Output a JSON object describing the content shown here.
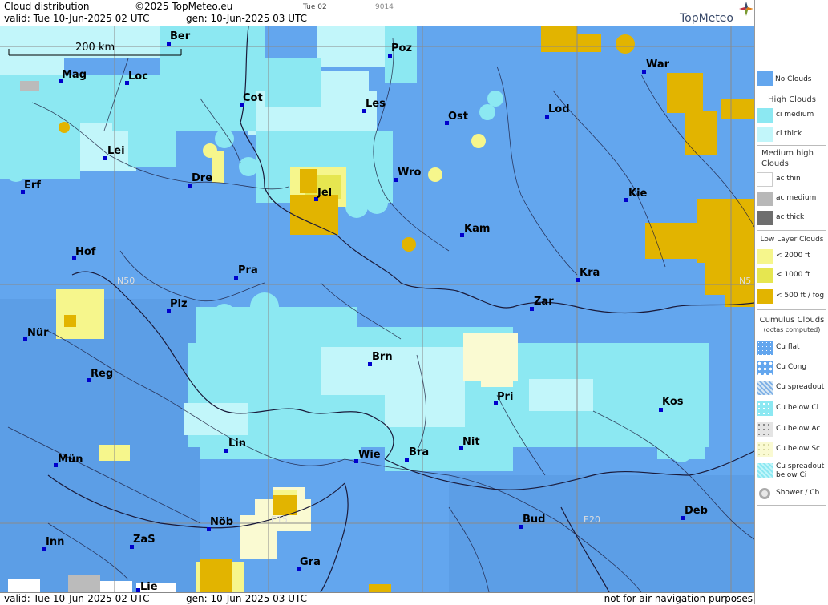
{
  "header": {
    "title": "Cloud distribution",
    "copyright": "©2025 TopMeteo.eu",
    "valid": "valid:  Tue  10-Jun-2025  02 UTC",
    "gen": "gen: 10-Jun-2025 03 UTC",
    "tab": "Tue 02",
    "code": "9014",
    "logo": "TopMeteo"
  },
  "footer": {
    "valid": "valid:  Tue  10-Jun-2025  02 UTC",
    "gen": "gen: 10-Jun-2025 03 UTC",
    "note": "not for air navigation purposes"
  },
  "map": {
    "scale_label": "200 km",
    "grid_labels": [
      "N50",
      "E15",
      "E20",
      "N5"
    ],
    "colors": {
      "no_clouds": "#63a6ee",
      "ci_medium": "#8ce8f2",
      "ci_thick": "#c2f6fa",
      "low_2000": "#f6f68c",
      "low_1000": "#e6e650",
      "fog": "#e2b400",
      "cu_below_sc": "#fafad2",
      "grid": "#8a8a8a",
      "border": "#222244"
    },
    "cities": [
      {
        "name": "Ber"
      },
      {
        "name": "Poz"
      },
      {
        "name": "War"
      },
      {
        "name": "Mag"
      },
      {
        "name": "Loc"
      },
      {
        "name": "Cot"
      },
      {
        "name": "Les"
      },
      {
        "name": "Ost"
      },
      {
        "name": "Lod"
      },
      {
        "name": "Lei"
      },
      {
        "name": "Wro"
      },
      {
        "name": "Erf"
      },
      {
        "name": "Dre"
      },
      {
        "name": "Jel"
      },
      {
        "name": "Kie"
      },
      {
        "name": "Kam"
      },
      {
        "name": "Hof"
      },
      {
        "name": "Pra"
      },
      {
        "name": "Kra"
      },
      {
        "name": "Zar"
      },
      {
        "name": "Plz"
      },
      {
        "name": "Nür"
      },
      {
        "name": "Brn"
      },
      {
        "name": "Reg"
      },
      {
        "name": "Pri"
      },
      {
        "name": "Kos"
      },
      {
        "name": "Lin"
      },
      {
        "name": "Nit"
      },
      {
        "name": "Mün"
      },
      {
        "name": "Wie"
      },
      {
        "name": "Bra"
      },
      {
        "name": "Nöb"
      },
      {
        "name": "Bud"
      },
      {
        "name": "Deb"
      },
      {
        "name": "Inn"
      },
      {
        "name": "ZaS"
      },
      {
        "name": "Gra"
      },
      {
        "name": "Lie"
      }
    ]
  },
  "legend": {
    "no_clouds": "No Clouds",
    "high_head": "High Clouds",
    "ci_medium": "ci medium",
    "ci_thick": "ci thick",
    "medium_head_1": "Medium high",
    "medium_head_2": "Clouds",
    "ac_thin": "ac thin",
    "ac_medium": "ac medium",
    "ac_thick": "ac thick",
    "low_head": "Low Layer Clouds",
    "low_2000": "< 2000 ft",
    "low_1000": "< 1000 ft",
    "low_500": "< 500 ft / fog",
    "cu_head_1": "Cumulus Clouds",
    "cu_head_2": "(octas computed)",
    "cu_flat": "Cu flat",
    "cu_cong": "Cu Cong",
    "cu_spreadout": "Cu spreadout",
    "cu_below_ci": "Cu below Ci",
    "cu_below_ac": "Cu below Ac",
    "cu_below_sc": "Cu below Sc",
    "cu_spread_ci_1": "Cu spreadout",
    "cu_spread_ci_2": "below Ci",
    "shower": "Shower / Cb"
  }
}
